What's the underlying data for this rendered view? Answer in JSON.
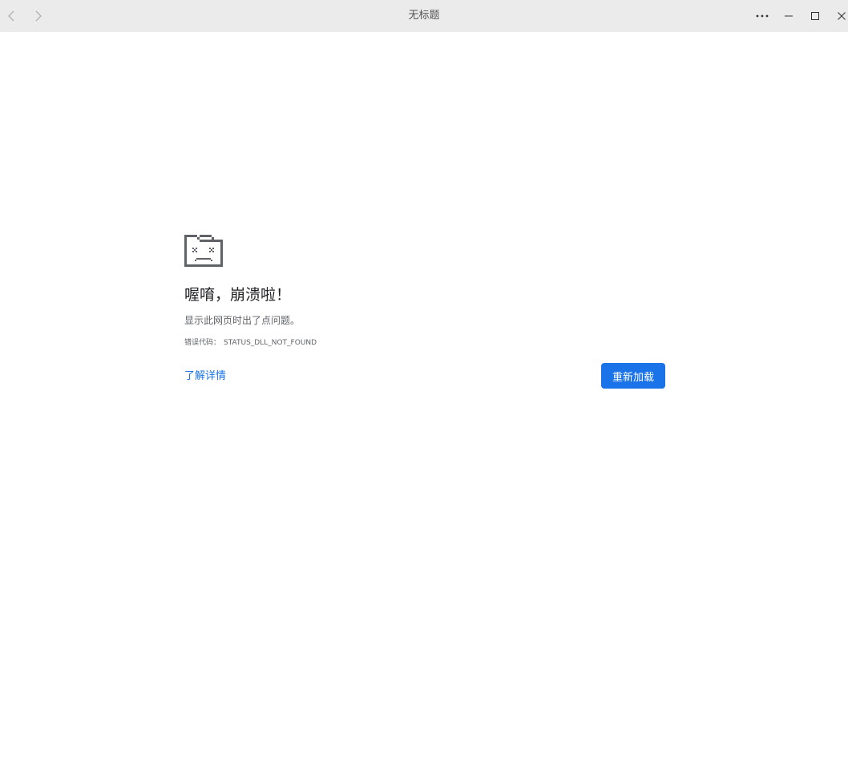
{
  "window": {
    "title": "无标题",
    "nav": {
      "back_icon": "chevron-left-icon",
      "forward_icon": "chevron-right-icon"
    },
    "controls": {
      "menu_icon": "more-horizontal-icon",
      "minimize_icon": "minimize-icon",
      "maximize_icon": "maximize-icon",
      "close_icon": "close-icon"
    }
  },
  "error_page": {
    "icon": "sad-tab-icon",
    "title": "喔唷，崩溃啦！",
    "description": "显示此网页时出了点问题。",
    "code_label": "错误代码：",
    "code_value": "STATUS_DLL_NOT_FOUND",
    "learn_more": "了解详情",
    "reload": "重新加载"
  },
  "colors": {
    "accent": "#1a73e8",
    "titlebar_bg": "#ebebeb",
    "icon_color": "#5f6368"
  }
}
